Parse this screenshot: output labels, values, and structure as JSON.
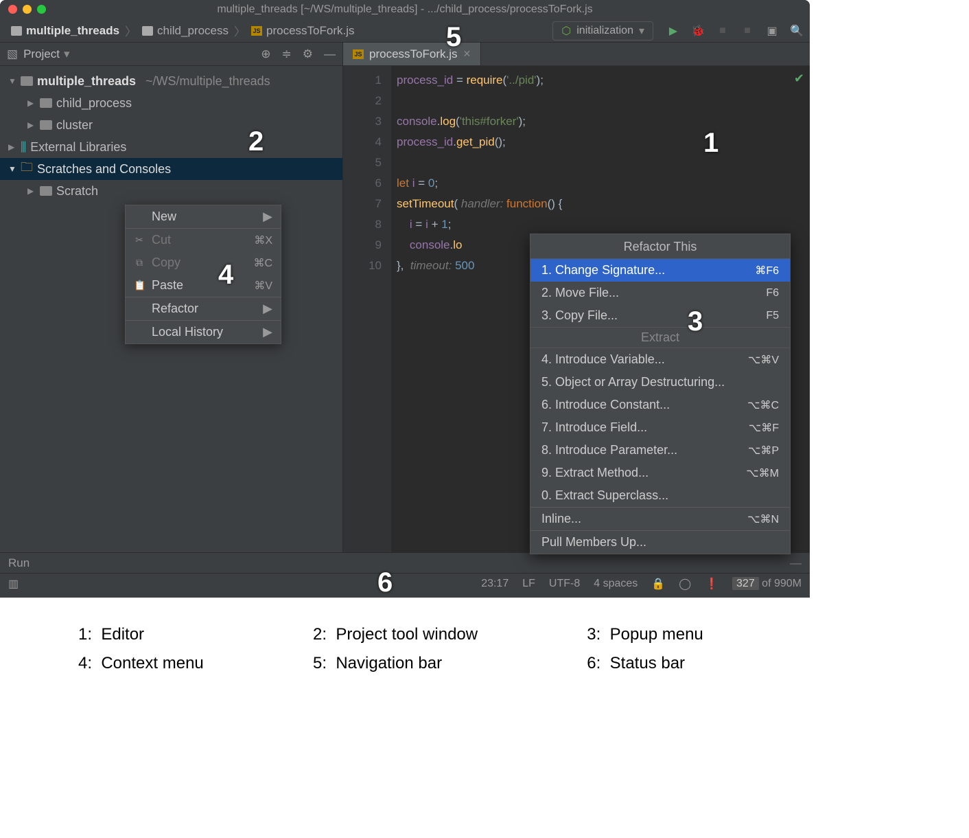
{
  "title": "multiple_threads [~/WS/multiple_threads] - .../child_process/processToFork.js",
  "breadcrumbs": {
    "a": "multiple_threads",
    "b": "child_process",
    "c": "processToFork.js"
  },
  "runconfig": "initialization",
  "nav_label_num": "5",
  "project": {
    "header": "Project",
    "root": "multiple_threads",
    "root_path": "~/WS/multiple_threads",
    "child1": "child_process",
    "child2": "cluster",
    "ext": "External Libraries",
    "scratches": "Scratches and Consoles",
    "scratch_sub": "Scratch"
  },
  "label2": "2",
  "editor": {
    "tab": "processToFork.js",
    "lines": {
      "l1": "1",
      "l2": "2",
      "l3": "3",
      "l4": "4",
      "l5": "5",
      "l6": "6",
      "l7": "7",
      "l8": "8",
      "l9": "9",
      "l10": "10"
    }
  },
  "label1": "1",
  "ctx": {
    "new": "New",
    "cut": "Cut",
    "cut_k": "⌘X",
    "copy": "Copy",
    "copy_k": "⌘C",
    "paste": "Paste",
    "paste_k": "⌘V",
    "refactor": "Refactor",
    "history": "Local History"
  },
  "label4": "4",
  "popup": {
    "title": "Refactor This",
    "r1": "1. Change Signature...",
    "k1": "⌘F6",
    "r2": "2. Move File...",
    "k2": "F6",
    "r3": "3. Copy File...",
    "k3": "F5",
    "sub": "Extract",
    "r4": "4. Introduce Variable...",
    "k4": "⌥⌘V",
    "r5": "5. Object or Array Destructuring...",
    "r6": "6. Introduce Constant...",
    "k6": "⌥⌘C",
    "r7": "7. Introduce Field...",
    "k7": "⌥⌘F",
    "r8": "8. Introduce Parameter...",
    "k8": "⌥⌘P",
    "r9": "9. Extract Method...",
    "k9": "⌥⌘M",
    "r0": "0. Extract Superclass...",
    "inline": "Inline...",
    "kinline": "⌥⌘N",
    "pull": "Pull Members Up..."
  },
  "label3": "3",
  "run_label": "Run",
  "status": {
    "pos": "23:17",
    "eol": "LF",
    "enc": "UTF-8",
    "indent": "4 spaces",
    "mem_a": "327",
    "mem_b": " of 990M"
  },
  "label6": "6",
  "legend": {
    "l1": "Editor",
    "l2": "Project tool window",
    "l3": "Popup menu",
    "l4": "Context menu",
    "l5": "Navigation bar",
    "l6": "Status bar"
  }
}
